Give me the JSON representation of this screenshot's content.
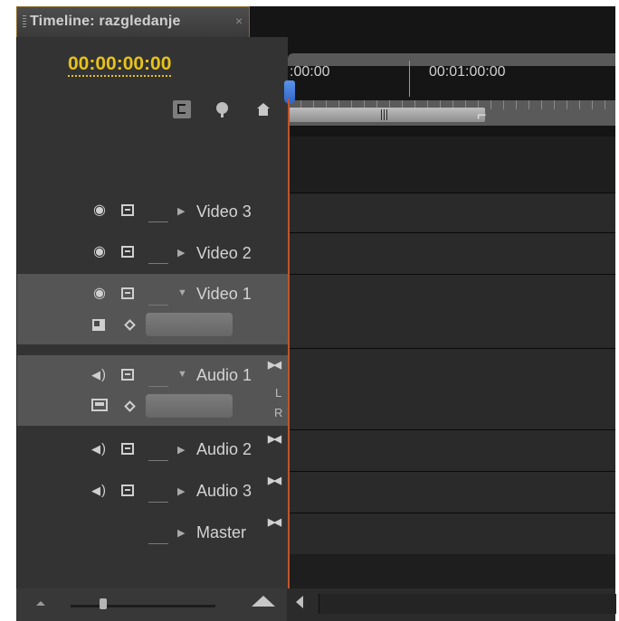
{
  "tab": {
    "title": "Timeline: razgledanje",
    "close": "×"
  },
  "timecode": "00:00:00:00",
  "ruler": {
    "labels": [
      ":00:00",
      "00:01:00:00"
    ]
  },
  "tracks": {
    "video3": {
      "name": "Video 3"
    },
    "video2": {
      "name": "Video 2"
    },
    "video1": {
      "name": "Video 1"
    },
    "audio1": {
      "name": "Audio 1",
      "left": "L",
      "right": "R"
    },
    "audio2": {
      "name": "Audio 2"
    },
    "audio3": {
      "name": "Audio 3"
    },
    "master": {
      "name": "Master"
    }
  },
  "colors": {
    "timecode": "#e8c21a",
    "playhead": "#3b72d6",
    "playhead_line": "#c0552b",
    "tab_border": "#8a6a2a"
  },
  "icons": [
    "snap-icon",
    "marker-icon",
    "home-icon",
    "eye-icon",
    "speaker-icon",
    "lock-icon",
    "keyframe-icon"
  ]
}
